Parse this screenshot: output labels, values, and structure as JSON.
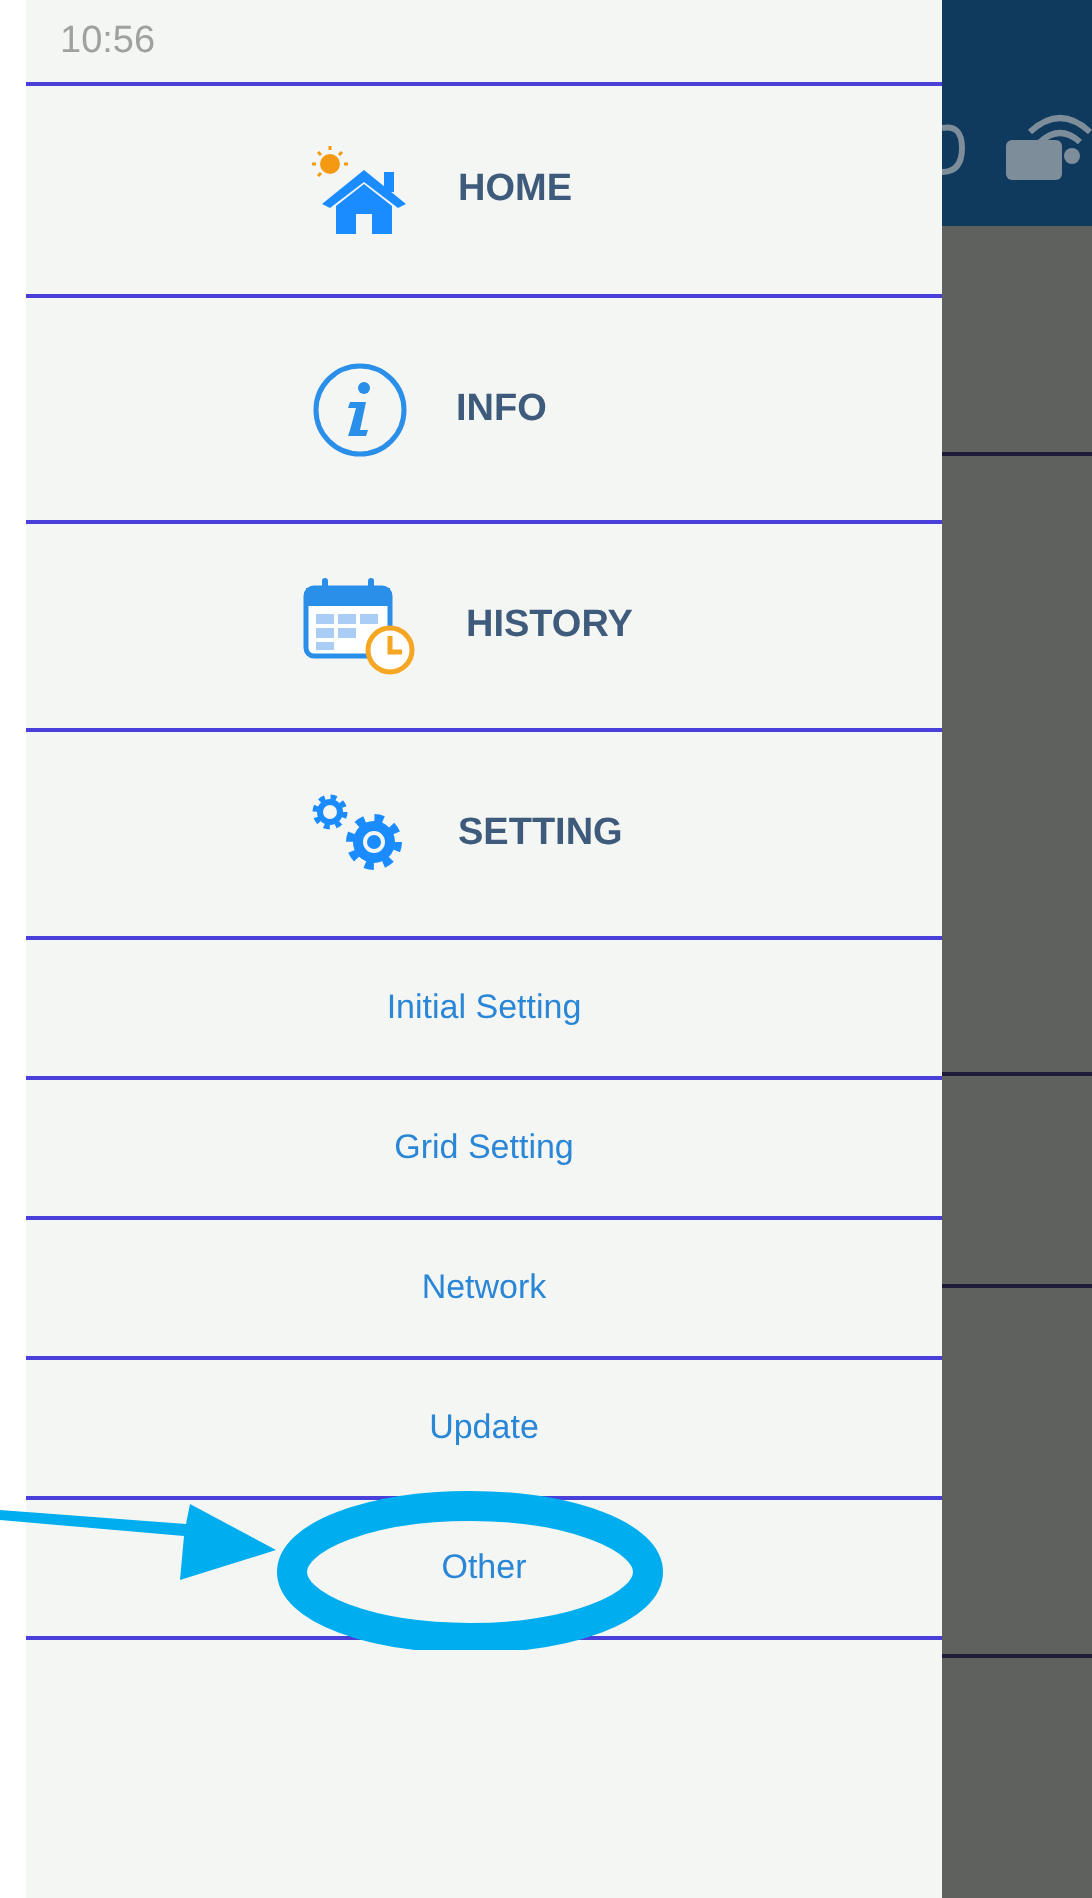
{
  "status_bar": {
    "time": "10:56"
  },
  "menu": [
    {
      "kind": "main",
      "label": "HOME"
    },
    {
      "kind": "main",
      "label": "INFO"
    },
    {
      "kind": "main",
      "label": "HISTORY"
    },
    {
      "kind": "main",
      "label": "SETTING"
    },
    {
      "kind": "sub",
      "label": "Initial Setting"
    },
    {
      "kind": "sub",
      "label": "Grid Setting"
    },
    {
      "kind": "sub",
      "label": "Network"
    },
    {
      "kind": "sub",
      "label": "Update"
    },
    {
      "kind": "sub",
      "label": "Other"
    }
  ]
}
